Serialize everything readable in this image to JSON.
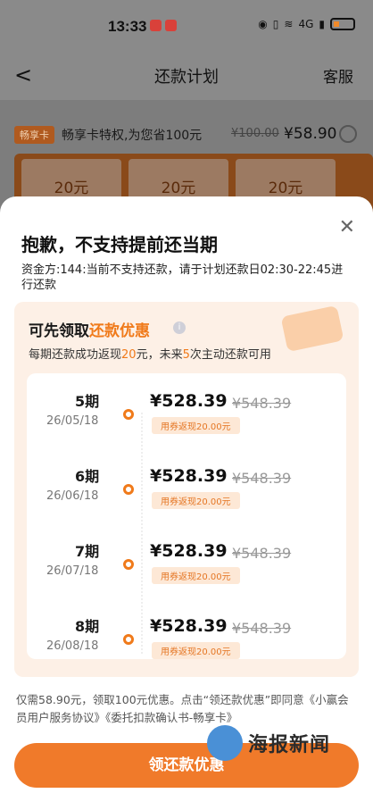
{
  "status_bar": {
    "time": "13:33",
    "network": "4G"
  },
  "header": {
    "back_icon": "chevron-left-icon",
    "title": "还款计划",
    "right_link": "客服"
  },
  "background": {
    "vip": {
      "badge": "畅享卡",
      "text": "畅享卡特权,为您省100元",
      "old_price": "¥100.00",
      "new_price": "¥58.90"
    },
    "coupons": [
      "20元",
      "20元",
      "20元"
    ]
  },
  "sheet": {
    "title": "抱歉，不支持提前还当期",
    "subtitle": "资金方:144:当前不支持还款，请于计划还款日02:30-22:45进行还款",
    "promo": {
      "title_prefix": "可先领取",
      "title_highlight": "还款优惠",
      "sub_a": "每期还款成功返现",
      "sub_amt": "20",
      "sub_b": "元，未来",
      "sub_cnt": "5",
      "sub_c": "次主动还款可用"
    },
    "plans": [
      {
        "period": "5期",
        "date": "26/05/18",
        "amount": "¥528.39",
        "old_amount": "¥548.39",
        "tag": "用券返现20.00元"
      },
      {
        "period": "6期",
        "date": "26/06/18",
        "amount": "¥528.39",
        "old_amount": "¥548.39",
        "tag": "用券返现20.00元"
      },
      {
        "period": "7期",
        "date": "26/07/18",
        "amount": "¥528.39",
        "old_amount": "¥548.39",
        "tag": "用券返现20.00元"
      },
      {
        "period": "8期",
        "date": "26/08/18",
        "amount": "¥528.39",
        "old_amount": "¥548.39",
        "tag": "用券返现20.00元"
      }
    ],
    "agreement": "仅需58.90元，领取100元优惠。点击“领还款优惠”即同意《小赢会员用户服务协议》《委托扣款确认书-畅享卡》",
    "cta": "领还款优惠"
  },
  "watermark": "海报新闻",
  "colors": {
    "accent": "#f07a1a"
  }
}
